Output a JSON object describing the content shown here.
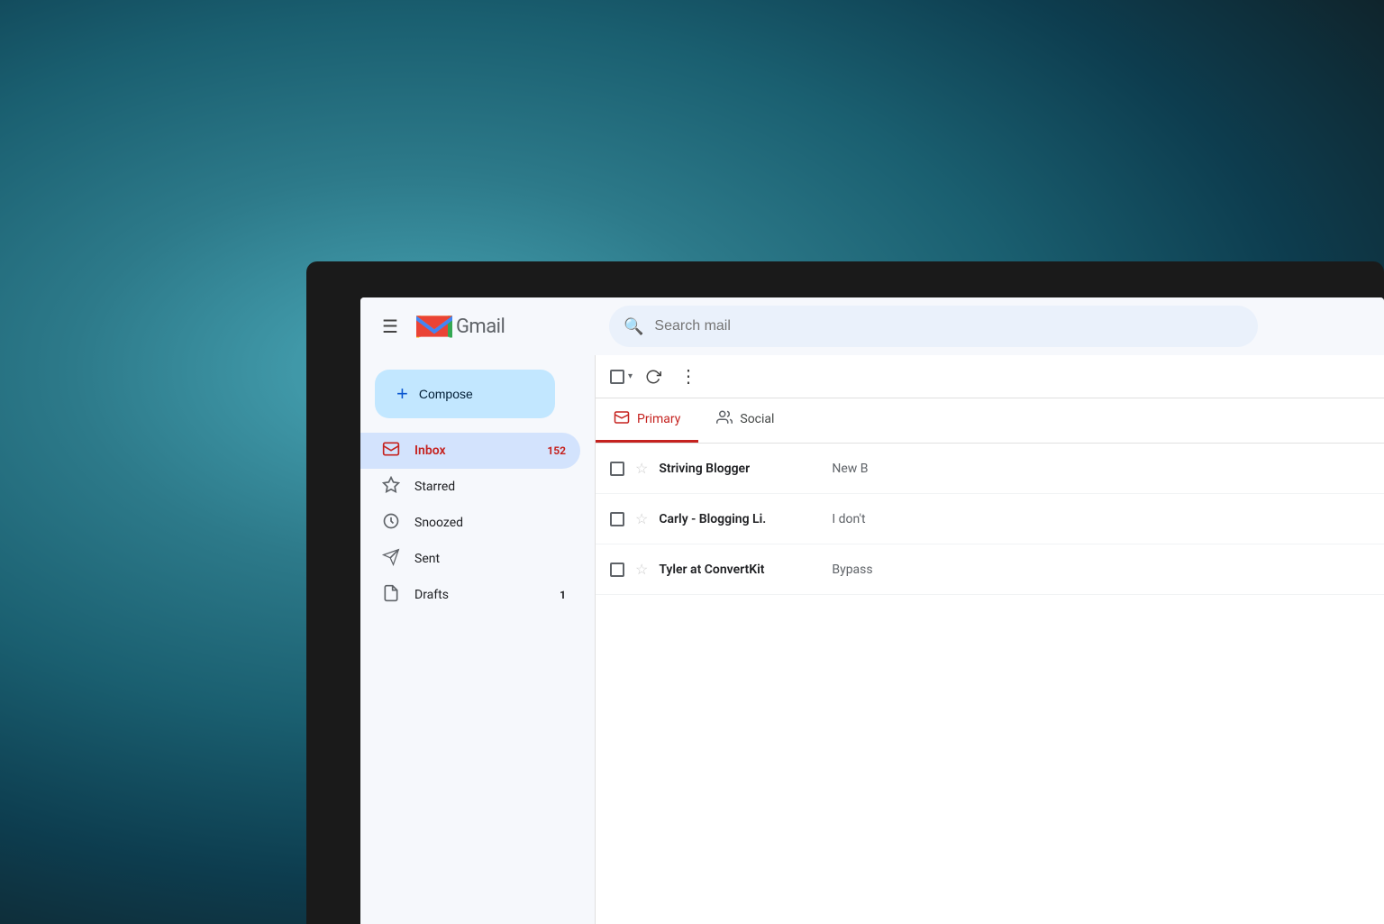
{
  "background": {
    "color_start": "#4aa8b8",
    "color_end": "#0d3d4f"
  },
  "header": {
    "hamburger_label": "☰",
    "gmail_text": "Gmail",
    "search_placeholder": "Search mail"
  },
  "sidebar": {
    "compose_label": "Compose",
    "compose_plus": "+",
    "items": [
      {
        "id": "inbox",
        "label": "Inbox",
        "icon": "☐",
        "count": "152",
        "active": true
      },
      {
        "id": "starred",
        "label": "Starred",
        "icon": "★",
        "count": "",
        "active": false
      },
      {
        "id": "snoozed",
        "label": "Snoozed",
        "icon": "🕐",
        "count": "",
        "active": false
      },
      {
        "id": "sent",
        "label": "Sent",
        "icon": "➤",
        "count": "",
        "active": false
      },
      {
        "id": "drafts",
        "label": "Drafts",
        "icon": "📄",
        "count": "1",
        "active": false
      }
    ]
  },
  "toolbar": {
    "more_label": "⋮",
    "refresh_label": "↻"
  },
  "tabs": [
    {
      "id": "primary",
      "label": "Primary",
      "icon": "🗂",
      "active": true
    },
    {
      "id": "social",
      "label": "Social",
      "icon": "👥",
      "active": false
    }
  ],
  "emails": [
    {
      "sender": "Striving Blogger",
      "preview": "New B",
      "date": "",
      "unread": true
    },
    {
      "sender": "Carly - Blogging Li.",
      "preview": "I don't",
      "date": "",
      "unread": true
    },
    {
      "sender": "Tyler at ConvertKit",
      "preview": "Bypass",
      "date": "",
      "unread": true
    }
  ],
  "colors": {
    "primary_tab_accent": "#c5221f",
    "inbox_active": "#c5221f",
    "compose_bg": "#c2e7ff",
    "search_bg": "#eaf1fb"
  }
}
